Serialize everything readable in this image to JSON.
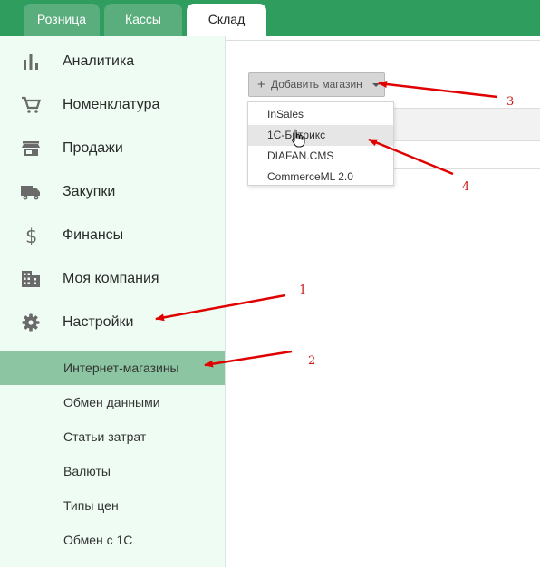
{
  "tabs": [
    {
      "label": "Розница",
      "active": false
    },
    {
      "label": "Кассы",
      "active": false
    },
    {
      "label": "Склад",
      "active": true
    }
  ],
  "sidebar": {
    "items": [
      {
        "label": "Аналитика",
        "icon": "bar-chart-icon"
      },
      {
        "label": "Номенклатура",
        "icon": "cart-icon"
      },
      {
        "label": "Продажи",
        "icon": "store-icon"
      },
      {
        "label": "Закупки",
        "icon": "truck-icon"
      },
      {
        "label": "Финансы",
        "icon": "dollar-icon"
      },
      {
        "label": "Моя компания",
        "icon": "building-icon"
      },
      {
        "label": "Настройки",
        "icon": "gear-icon"
      }
    ],
    "sub_items": [
      {
        "label": "Интернет-магазины",
        "active": true
      },
      {
        "label": "Обмен данными",
        "active": false
      },
      {
        "label": "Статьи затрат",
        "active": false
      },
      {
        "label": "Валюты",
        "active": false
      },
      {
        "label": "Типы цен",
        "active": false
      },
      {
        "label": "Обмен с 1С",
        "active": false
      }
    ]
  },
  "main": {
    "add_button": {
      "plus": "+",
      "label": "Добавить магазин"
    },
    "dropdown": {
      "items": [
        "InSales",
        "1С-Битрикс",
        "DIAFAN.CMS",
        "CommerceML 2.0"
      ],
      "hovered": "1С-Битрикс"
    }
  },
  "annotations": [
    {
      "number": "1"
    },
    {
      "number": "2"
    },
    {
      "number": "3"
    },
    {
      "number": "4"
    }
  ],
  "colors": {
    "topbar": "#2e9d5d",
    "tab_inactive": "#5aae7d",
    "sidebar_bg": "#eefcf3",
    "active_sub_item": "#8cc5a1",
    "annotation_red": "#e00000"
  }
}
